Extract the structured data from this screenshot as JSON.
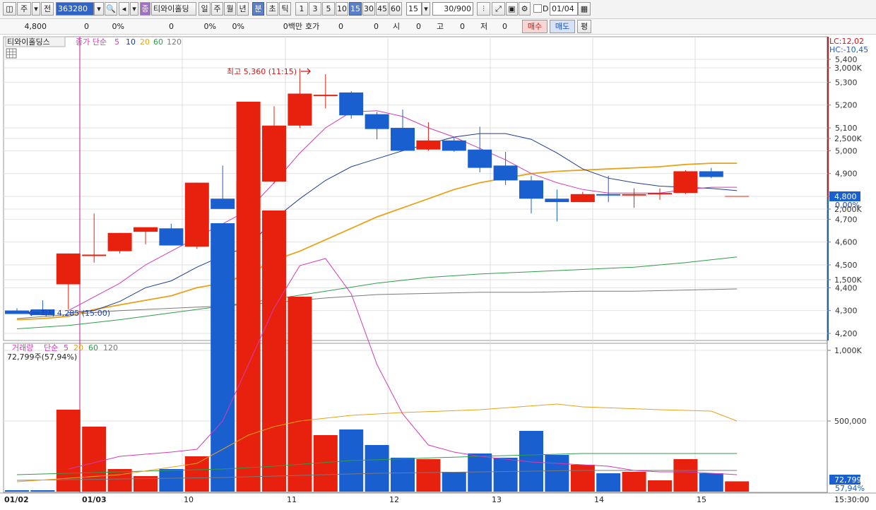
{
  "toolbar": {
    "chart_type": "주",
    "prev_label": "전",
    "code": "363280",
    "stock_badge": "종",
    "stock_name": "티와이홀딩",
    "periods": [
      "일",
      "주",
      "월",
      "년",
      "분",
      "초",
      "틱"
    ],
    "active_period": "분",
    "intervals": [
      "1",
      "3",
      "5",
      "10",
      "15",
      "30",
      "45",
      "60"
    ],
    "active_interval": "15",
    "interval_value": "15",
    "count": "30/900",
    "checkbox_label": "D",
    "date": "01/04"
  },
  "quote": {
    "price": "4,800",
    "change": "0",
    "rate1": "0%",
    "val2": "0",
    "rate2": "0%",
    "rate3": "0%",
    "volume": "0백만",
    "hoga_label": "호가",
    "hoga1": "0",
    "hoga2": "0",
    "open_label": "시",
    "open": "0",
    "high_label": "고",
    "high": "0",
    "low_label": "저",
    "low": "0",
    "buy_label": "매수",
    "sell_label": "매도",
    "eval_label": "평"
  },
  "legend_price": {
    "name": "티와이홀딩스",
    "series_label": "종가 단순",
    "periods": [
      "5",
      "10",
      "20",
      "60",
      "120"
    ]
  },
  "legend_volume": {
    "name": "거래량",
    "series_label": "단순",
    "periods": [
      "5",
      "20",
      "60",
      "120"
    ],
    "info": "72,799주(57,94%)"
  },
  "annotations": {
    "high": "최고 5,360 (11:15)",
    "low": "최저 4,285 (15:00)",
    "lc": "LC:12,02",
    "hc": "HC:-10,45"
  },
  "y_labels": {
    "price": [
      "5,400",
      "5,300",
      "5,200",
      "5,100",
      "5,000",
      "4,900",
      "4,800",
      "4,700",
      "4,600",
      "4,500",
      "4,400",
      "4,300",
      "4,200"
    ],
    "volume": [
      "3,000K",
      "2,500K",
      "2,000K",
      "1,500K",
      "1,000K",
      "500,000"
    ]
  },
  "current": {
    "price_tag": "4,800",
    "price_pct": "0,00%",
    "vol_tag": "72,799",
    "vol_pct": "57,94%"
  },
  "x_labels": [
    "01/02",
    "01/03",
    "10",
    "11",
    "12",
    "13",
    "14",
    "15",
    "15:30:00"
  ],
  "colors": {
    "up": "#e8200e",
    "down": "#1a5fd0",
    "ma5": "#d23cb4",
    "ma10": "#1f3d8f",
    "ma20": "#e8a21a",
    "ma60": "#2f9c4a",
    "ma120": "#7a7a7a"
  },
  "chart_data": {
    "type": "candlestick",
    "price_ylim": [
      4200,
      5400
    ],
    "volume_ylim": [
      0,
      3000000
    ],
    "candles": [
      {
        "o": 4300,
        "h": 4310,
        "l": 4285,
        "c": 4285
      },
      {
        "o": 4305,
        "h": 4345,
        "l": 4285,
        "c": 4280
      },
      {
        "o": 4415,
        "h": 4550,
        "l": 4305,
        "c": 4550
      },
      {
        "o": 4545,
        "h": 4725,
        "l": 4510,
        "c": 4545
      },
      {
        "o": 4560,
        "h": 4640,
        "l": 4550,
        "c": 4640
      },
      {
        "o": 4645,
        "h": 4660,
        "l": 4590,
        "c": 4665
      },
      {
        "o": 4660,
        "h": 4680,
        "l": 4590,
        "c": 4585
      },
      {
        "o": 4580,
        "h": 4860,
        "l": 4570,
        "c": 4860
      },
      {
        "o": 4790,
        "h": 4935,
        "l": 4750,
        "c": 4745
      },
      {
        "o": 4750,
        "h": 5085,
        "l": 4690,
        "c": 4865
      },
      {
        "o": 4865,
        "h": 5195,
        "l": 4855,
        "c": 5110
      },
      {
        "o": 5110,
        "h": 5360,
        "l": 5100,
        "c": 5250
      },
      {
        "o": 5240,
        "h": 5335,
        "l": 5185,
        "c": 5245
      },
      {
        "o": 5255,
        "h": 5260,
        "l": 5140,
        "c": 5155
      },
      {
        "o": 5160,
        "h": 5170,
        "l": 5050,
        "c": 5095
      },
      {
        "o": 5100,
        "h": 5180,
        "l": 5000,
        "c": 5000
      },
      {
        "o": 5005,
        "h": 5125,
        "l": 5000,
        "c": 5045
      },
      {
        "o": 5045,
        "h": 5060,
        "l": 4995,
        "c": 5000
      },
      {
        "o": 5005,
        "h": 5105,
        "l": 4905,
        "c": 4925
      },
      {
        "o": 4935,
        "h": 4995,
        "l": 4850,
        "c": 4870
      },
      {
        "o": 4870,
        "h": 4890,
        "l": 4725,
        "c": 4790
      },
      {
        "o": 4790,
        "h": 4830,
        "l": 4690,
        "c": 4775
      },
      {
        "o": 4775,
        "h": 4820,
        "l": 4775,
        "c": 4810
      },
      {
        "o": 4810,
        "h": 4890,
        "l": 4775,
        "c": 4805
      },
      {
        "o": 4805,
        "h": 4835,
        "l": 4750,
        "c": 4810
      },
      {
        "o": 4810,
        "h": 4835,
        "l": 4785,
        "c": 4815
      },
      {
        "o": 4815,
        "h": 4915,
        "l": 4810,
        "c": 4910
      },
      {
        "o": 4910,
        "h": 4925,
        "l": 4880,
        "c": 4885
      },
      {
        "o": 4800,
        "h": 4800,
        "l": 4800,
        "c": 4800
      }
    ],
    "volume": [
      0,
      0,
      580000,
      460000,
      160000,
      110000,
      160000,
      250000,
      1900000,
      2760000,
      1990000,
      1380000,
      400000,
      440000,
      330000,
      240000,
      230000,
      140000,
      270000,
      240000,
      430000,
      260000,
      190000,
      130000,
      140000,
      80000,
      230000,
      130000,
      72799
    ],
    "ma": {
      "ma5": [
        [
          2,
          4300
        ],
        [
          3,
          4360
        ],
        [
          4,
          4420
        ],
        [
          5,
          4500
        ],
        [
          6,
          4560
        ],
        [
          7,
          4620
        ],
        [
          8,
          4680
        ],
        [
          9,
          4740
        ],
        [
          10,
          4860
        ],
        [
          11,
          4990
        ],
        [
          12,
          5100
        ],
        [
          13,
          5170
        ],
        [
          14,
          5175
        ],
        [
          15,
          5150
        ],
        [
          16,
          5100
        ],
        [
          17,
          5060
        ],
        [
          18,
          5010
        ],
        [
          19,
          4960
        ],
        [
          20,
          4900
        ],
        [
          21,
          4860
        ],
        [
          22,
          4830
        ],
        [
          23,
          4815
        ],
        [
          24,
          4815
        ],
        [
          25,
          4815
        ],
        [
          26,
          4830
        ],
        [
          27,
          4840
        ],
        [
          28,
          4840
        ]
      ],
      "ma10": [
        [
          2,
          4290
        ],
        [
          3,
          4300
        ],
        [
          4,
          4340
        ],
        [
          5,
          4400
        ],
        [
          6,
          4430
        ],
        [
          7,
          4490
        ],
        [
          8,
          4540
        ],
        [
          9,
          4580
        ],
        [
          10,
          4700
        ],
        [
          11,
          4790
        ],
        [
          12,
          4870
        ],
        [
          13,
          4930
        ],
        [
          14,
          4965
        ],
        [
          15,
          5000
        ],
        [
          16,
          5030
        ],
        [
          17,
          5060
        ],
        [
          18,
          5075
        ],
        [
          19,
          5075
        ],
        [
          20,
          5050
        ],
        [
          21,
          4990
        ],
        [
          22,
          4920
        ],
        [
          23,
          4880
        ],
        [
          24,
          4860
        ],
        [
          25,
          4845
        ],
        [
          26,
          4840
        ],
        [
          27,
          4835
        ],
        [
          28,
          4825
        ]
      ],
      "ma20": [
        [
          0,
          4260
        ],
        [
          1,
          4265
        ],
        [
          2,
          4275
        ],
        [
          3,
          4305
        ],
        [
          4,
          4325
        ],
        [
          5,
          4345
        ],
        [
          6,
          4365
        ],
        [
          7,
          4400
        ],
        [
          8,
          4420
        ],
        [
          9,
          4460
        ],
        [
          10,
          4520
        ],
        [
          11,
          4560
        ],
        [
          12,
          4610
        ],
        [
          13,
          4660
        ],
        [
          14,
          4710
        ],
        [
          15,
          4750
        ],
        [
          16,
          4790
        ],
        [
          17,
          4830
        ],
        [
          18,
          4860
        ],
        [
          19,
          4880
        ],
        [
          20,
          4900
        ],
        [
          21,
          4910
        ],
        [
          22,
          4915
        ],
        [
          23,
          4920
        ],
        [
          24,
          4925
        ],
        [
          25,
          4930
        ],
        [
          26,
          4940
        ],
        [
          27,
          4945
        ],
        [
          28,
          4945
        ]
      ],
      "ma60": [
        [
          0,
          4220
        ],
        [
          2,
          4235
        ],
        [
          4,
          4260
        ],
        [
          6,
          4290
        ],
        [
          8,
          4320
        ],
        [
          10,
          4350
        ],
        [
          12,
          4385
        ],
        [
          14,
          4420
        ],
        [
          16,
          4445
        ],
        [
          18,
          4460
        ],
        [
          20,
          4470
        ],
        [
          22,
          4480
        ],
        [
          24,
          4490
        ],
        [
          26,
          4510
        ],
        [
          28,
          4535
        ]
      ],
      "ma120": [
        [
          0,
          4265
        ],
        [
          4,
          4300
        ],
        [
          8,
          4320
        ],
        [
          10,
          4335
        ],
        [
          12,
          4355
        ],
        [
          14,
          4370
        ],
        [
          16,
          4375
        ],
        [
          18,
          4380
        ],
        [
          20,
          4380
        ],
        [
          22,
          4385
        ],
        [
          24,
          4385
        ],
        [
          26,
          4390
        ],
        [
          28,
          4395
        ]
      ],
      "vma5": [
        [
          2,
          160000
        ],
        [
          4,
          250000
        ],
        [
          6,
          280000
        ],
        [
          7,
          300000
        ],
        [
          8,
          500000
        ],
        [
          9,
          900000
        ],
        [
          10,
          1300000
        ],
        [
          11,
          1600000
        ],
        [
          12,
          1650000
        ],
        [
          13,
          1400000
        ],
        [
          14,
          900000
        ],
        [
          15,
          550000
        ],
        [
          16,
          330000
        ],
        [
          17,
          280000
        ],
        [
          18,
          250000
        ],
        [
          19,
          230000
        ],
        [
          20,
          210000
        ],
        [
          21,
          200000
        ],
        [
          22,
          190000
        ],
        [
          23,
          180000
        ],
        [
          24,
          150000
        ],
        [
          25,
          140000
        ],
        [
          26,
          140000
        ],
        [
          27,
          130000
        ],
        [
          28,
          120000
        ]
      ],
      "vma20": [
        [
          0,
          70000
        ],
        [
          4,
          120000
        ],
        [
          7,
          200000
        ],
        [
          9,
          400000
        ],
        [
          10,
          460000
        ],
        [
          11,
          500000
        ],
        [
          13,
          540000
        ],
        [
          15,
          560000
        ],
        [
          18,
          580000
        ],
        [
          21,
          620000
        ],
        [
          22,
          600000
        ],
        [
          25,
          580000
        ],
        [
          27,
          570000
        ],
        [
          28,
          500000
        ]
      ],
      "vma60": [
        [
          0,
          120000
        ],
        [
          8,
          160000
        ],
        [
          10,
          180000
        ],
        [
          13,
          220000
        ],
        [
          18,
          250000
        ],
        [
          22,
          270000
        ],
        [
          28,
          270000
        ]
      ],
      "vma120": [
        [
          0,
          80000
        ],
        [
          8,
          100000
        ],
        [
          14,
          130000
        ],
        [
          22,
          150000
        ],
        [
          28,
          150000
        ]
      ]
    }
  }
}
